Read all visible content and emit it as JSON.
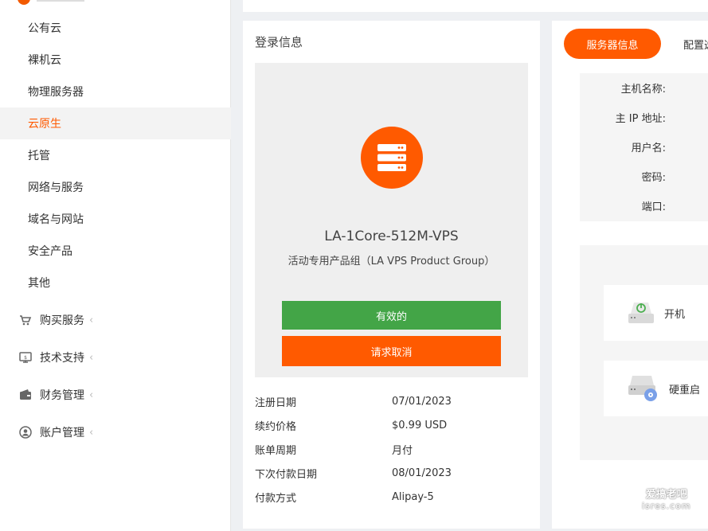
{
  "sidebar": {
    "sub_items": [
      {
        "label": "公有云",
        "active": false
      },
      {
        "label": "裸机云",
        "active": false
      },
      {
        "label": "物理服务器",
        "active": false
      },
      {
        "label": "云原生",
        "active": true
      },
      {
        "label": "托管",
        "active": false
      },
      {
        "label": "网络与服务",
        "active": false
      },
      {
        "label": "域名与网站",
        "active": false
      },
      {
        "label": "安全产品",
        "active": false
      },
      {
        "label": "其他",
        "active": false
      }
    ],
    "menu_items": [
      {
        "label": "购买服务",
        "icon": "cart-icon"
      },
      {
        "label": "技术支持",
        "icon": "monitor-icon"
      },
      {
        "label": "财务管理",
        "icon": "wallet-icon"
      },
      {
        "label": "账户管理",
        "icon": "user-icon"
      }
    ],
    "chevron": "‹"
  },
  "login_card": {
    "title": "登录信息",
    "product_name": "LA-1Core-512M-VPS",
    "product_group": "活动专用产品组（LA VPS Product Group）",
    "status_button": "有效的",
    "cancel_button": "请求取消",
    "info": [
      {
        "label": "注册日期",
        "value": "07/01/2023"
      },
      {
        "label": "续约价格",
        "value": "$0.99 USD"
      },
      {
        "label": "账单周期",
        "value": "月付"
      },
      {
        "label": "下次付款日期",
        "value": "08/01/2023"
      },
      {
        "label": "付款方式",
        "value": "Alipay-5"
      }
    ]
  },
  "server_card": {
    "tab_active": "服务器信息",
    "tab_config": "配置选",
    "details": [
      {
        "label": "主机名称:"
      },
      {
        "label": "主 IP 地址:"
      },
      {
        "label": "用户名:"
      },
      {
        "label": "密码:"
      },
      {
        "label": "端口:"
      }
    ],
    "actions": [
      {
        "label": "开机",
        "icon": "power-on-icon"
      },
      {
        "label": "硬重启",
        "icon": "hard-reboot-icon"
      }
    ]
  },
  "watermark": {
    "line1": "爱搞老吧",
    "line2": "isres.com"
  },
  "colors": {
    "accent": "#ff5a00",
    "success": "#43a547"
  }
}
